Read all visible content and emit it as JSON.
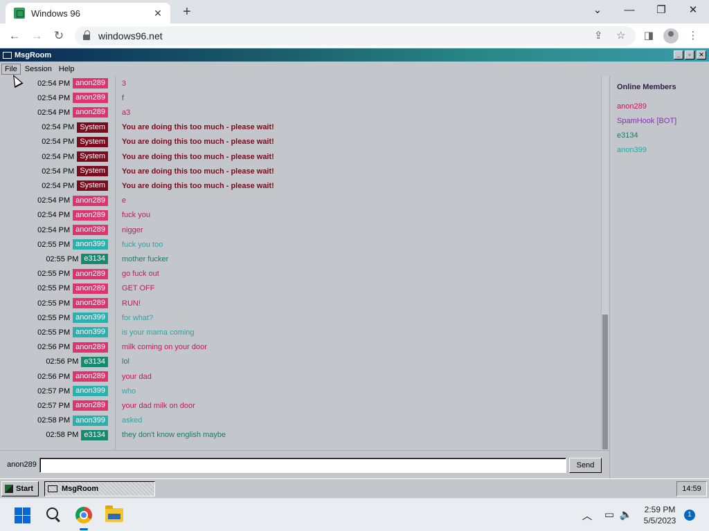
{
  "browser": {
    "tab_title": "Windows 96",
    "new_tab": "+",
    "url": "windows96.net"
  },
  "app": {
    "title": "MsgRoom",
    "menu": [
      "File",
      "Session",
      "Help"
    ],
    "messages": [
      {
        "time": "02:54 PM",
        "user": "anon289",
        "text": "3"
      },
      {
        "time": "02:54 PM",
        "user": "anon289",
        "text": "f"
      },
      {
        "time": "02:54 PM",
        "user": "anon289",
        "text": "a3"
      },
      {
        "time": "02:54 PM",
        "user": "System",
        "text": "You are doing this too much - please wait!"
      },
      {
        "time": "02:54 PM",
        "user": "System",
        "text": "You are doing this too much - please wait!"
      },
      {
        "time": "02:54 PM",
        "user": "System",
        "text": "You are doing this too much - please wait!"
      },
      {
        "time": "02:54 PM",
        "user": "System",
        "text": "You are doing this too much - please wait!"
      },
      {
        "time": "02:54 PM",
        "user": "System",
        "text": "You are doing this too much - please wait!"
      },
      {
        "time": "02:54 PM",
        "user": "anon289",
        "text": "e"
      },
      {
        "time": "02:54 PM",
        "user": "anon289",
        "text": "fuck you"
      },
      {
        "time": "02:54 PM",
        "user": "anon289",
        "text": "nigger"
      },
      {
        "time": "02:55 PM",
        "user": "anon399",
        "text": "fuck you too"
      },
      {
        "time": "02:55 PM",
        "user": "e3134",
        "text": "mother fucker"
      },
      {
        "time": "02:55 PM",
        "user": "anon289",
        "text": "go fuck out"
      },
      {
        "time": "02:55 PM",
        "user": "anon289",
        "text": "GET OFF"
      },
      {
        "time": "02:55 PM",
        "user": "anon289",
        "text": "RUN!"
      },
      {
        "time": "02:55 PM",
        "user": "anon399",
        "text": "for what?"
      },
      {
        "time": "02:55 PM",
        "user": "anon399",
        "text": "is your mama coming"
      },
      {
        "time": "02:56 PM",
        "user": "anon289",
        "text": "milk coming on your door"
      },
      {
        "time": "02:56 PM",
        "user": "e3134",
        "text": "lol"
      },
      {
        "time": "02:56 PM",
        "user": "anon289",
        "text": "your dad"
      },
      {
        "time": "02:57 PM",
        "user": "anon399",
        "text": "who"
      },
      {
        "time": "02:57 PM",
        "user": "anon289",
        "text": "your dad milk on door"
      },
      {
        "time": "02:58 PM",
        "user": "anon399",
        "text": "asked"
      },
      {
        "time": "02:58 PM",
        "user": "e3134",
        "text": "they don't know english maybe"
      }
    ],
    "members_title": "Online Members",
    "members": [
      "anon289",
      "SpamHook [BOT]",
      "e3134",
      "anon399"
    ],
    "composer": {
      "username": "anon289",
      "input_value": "",
      "send_label": "Send"
    },
    "user_colors": {
      "anon289": {
        "badge": "#e0336e",
        "text": "#c2185b"
      },
      "anon399": {
        "badge": "#2bb0b0",
        "text": "#2aa5a5"
      },
      "e3134": {
        "badge": "#158a6e",
        "text": "#1e7a5e"
      },
      "System": {
        "badge": "#7a0a1e",
        "text": "#7a0a1e"
      },
      "SpamHook [BOT]": {
        "badge": "#8a2bb8",
        "text": "#8a2bb8"
      }
    }
  },
  "taskbar96": {
    "start_label": "Start",
    "task_label": "MsgRoom",
    "clock": "14:59"
  },
  "win11": {
    "time": "2:59 PM",
    "date": "5/5/2023",
    "notifications": "1"
  }
}
